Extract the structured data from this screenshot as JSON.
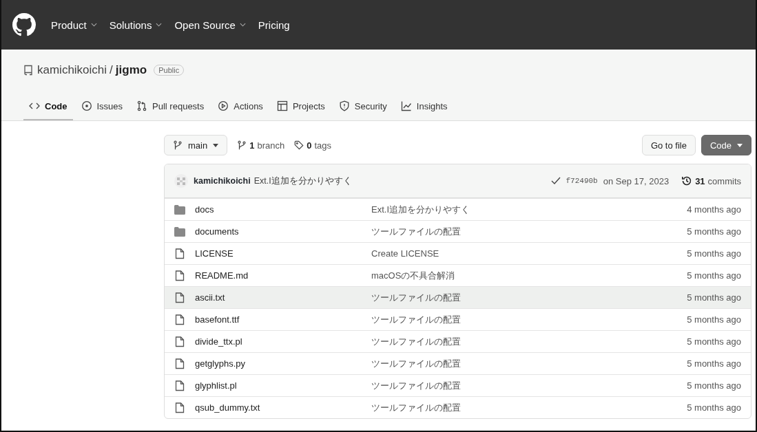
{
  "header": {
    "nav": [
      {
        "label": "Product",
        "dropdown": true
      },
      {
        "label": "Solutions",
        "dropdown": true
      },
      {
        "label": "Open Source",
        "dropdown": true
      },
      {
        "label": "Pricing",
        "dropdown": false
      }
    ]
  },
  "repo": {
    "owner": "kamichikoichi",
    "separator": "/",
    "name": "jigmo",
    "visibility": "Public"
  },
  "tabs": [
    {
      "label": "Code",
      "selected": true
    },
    {
      "label": "Issues",
      "selected": false
    },
    {
      "label": "Pull requests",
      "selected": false
    },
    {
      "label": "Actions",
      "selected": false
    },
    {
      "label": "Projects",
      "selected": false
    },
    {
      "label": "Security",
      "selected": false
    },
    {
      "label": "Insights",
      "selected": false
    }
  ],
  "branch_bar": {
    "branch": "main",
    "branch_count": "1",
    "branch_label": "branch",
    "tag_count": "0",
    "tag_label": "tags",
    "go_to_file": "Go to file",
    "code_button": "Code"
  },
  "commit": {
    "author": "kamichikoichi",
    "message": "Ext.I追加を分かりやすく",
    "hash": "f72490b",
    "date": "on Sep 17, 2023",
    "count": "31",
    "count_label": "commits"
  },
  "files": [
    {
      "kind": "folder",
      "name": "docs",
      "message": "Ext.I追加を分かりやすく",
      "age": "4 months ago",
      "hovered": false
    },
    {
      "kind": "folder",
      "name": "documents",
      "message": "ツールファイルの配置",
      "age": "5 months ago",
      "hovered": false
    },
    {
      "kind": "file",
      "name": "LICENSE",
      "message": "Create LICENSE",
      "age": "5 months ago",
      "hovered": false
    },
    {
      "kind": "file",
      "name": "README.md",
      "message": "macOSの不具合解消",
      "age": "5 months ago",
      "hovered": false
    },
    {
      "kind": "file",
      "name": "ascii.txt",
      "message": "ツールファイルの配置",
      "age": "5 months ago",
      "hovered": true
    },
    {
      "kind": "file",
      "name": "basefont.ttf",
      "message": "ツールファイルの配置",
      "age": "5 months ago",
      "hovered": false
    },
    {
      "kind": "file",
      "name": "divide_ttx.pl",
      "message": "ツールファイルの配置",
      "age": "5 months ago",
      "hovered": false
    },
    {
      "kind": "file",
      "name": "getglyphs.py",
      "message": "ツールファイルの配置",
      "age": "5 months ago",
      "hovered": false
    },
    {
      "kind": "file",
      "name": "glyphlist.pl",
      "message": "ツールファイルの配置",
      "age": "5 months ago",
      "hovered": false
    },
    {
      "kind": "file",
      "name": "qsub_dummy.txt",
      "message": "ツールファイルの配置",
      "age": "5 months ago",
      "hovered": false
    }
  ]
}
